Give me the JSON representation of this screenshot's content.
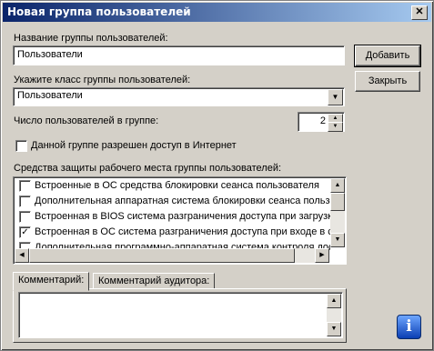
{
  "window": {
    "title": "Новая группа пользователей",
    "close_glyph": "✕"
  },
  "group_name": {
    "label": "Название группы пользователей:",
    "value": "Пользователи"
  },
  "group_class": {
    "label": "Укажите класс группы пользователей:",
    "value": "Пользователи"
  },
  "user_count": {
    "label": "Число пользователей в группе:",
    "value": "2"
  },
  "internet_access": {
    "label": "Данной группе разрешен доступ в Интернет",
    "checked": false
  },
  "buttons": {
    "add": "Добавить",
    "close": "Закрыть"
  },
  "protection": {
    "label": "Средства защиты рабочего места группы пользователей:",
    "items": [
      {
        "text": "Встроенные в ОС средства блокировки сеанса пользователя",
        "checked": false
      },
      {
        "text": "Дополнительная аппаратная система блокировки сеанса пользователя",
        "checked": false
      },
      {
        "text": "Встроенная в BIOS система разграничения доступа при загрузке",
        "checked": false
      },
      {
        "text": "Встроенная в ОС система разграничения доступа при входе в систему",
        "checked": true
      },
      {
        "text": "Дополнительная программно-аппаратная система контроля доступа",
        "checked": false
      }
    ]
  },
  "tabs": [
    {
      "label": "Комментарий:"
    },
    {
      "label": "Комментарий аудитора:"
    }
  ],
  "comment": {
    "value": ""
  },
  "icons": {
    "info": "i"
  }
}
